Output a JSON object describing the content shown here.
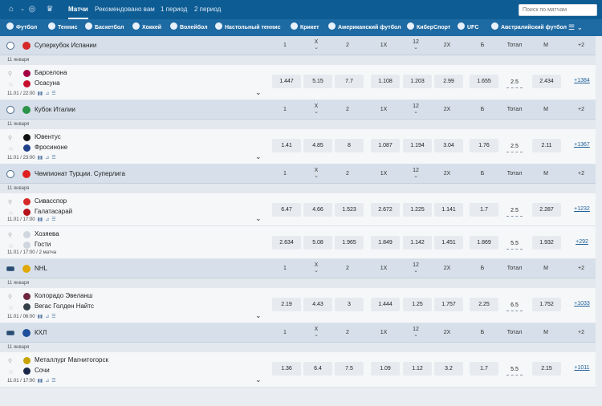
{
  "topbar": {
    "tabs": [
      {
        "label": "Матчи",
        "active": true
      },
      {
        "label": "Рекомендовано вам",
        "active": false
      },
      {
        "label": "1 период",
        "active": false
      },
      {
        "label": "2 период",
        "active": false
      }
    ],
    "search_placeholder": "Поиск по матчам"
  },
  "sports": [
    {
      "label": "Футбол",
      "icon": "football-icon"
    },
    {
      "label": "Теннис",
      "icon": "tennis-icon"
    },
    {
      "label": "Баскетбол",
      "icon": "basketball-icon"
    },
    {
      "label": "Хоккей",
      "icon": "hockey-icon"
    },
    {
      "label": "Волейбол",
      "icon": "volleyball-icon"
    },
    {
      "label": "Настольный теннис",
      "icon": "table-tennis-icon"
    },
    {
      "label": "Крикет",
      "icon": "cricket-icon"
    },
    {
      "label": "Американский футбол",
      "icon": "american-football-icon"
    },
    {
      "label": "КиберСпорт",
      "icon": "esports-icon"
    },
    {
      "label": "UFC",
      "icon": "ufc-icon"
    },
    {
      "label": "Австралийский футбол",
      "icon": "aussie-rules-icon"
    }
  ],
  "columns": [
    "1",
    "X",
    "2",
    "1X",
    "12",
    "2X",
    "Б",
    "Тотал",
    "М",
    "+2"
  ],
  "leagues": [
    {
      "name": "Суперкубок Испании",
      "sport": "football",
      "flag_color": "#d62828",
      "date": "11 января",
      "events": [
        {
          "team1": "Барселона",
          "team2": "Осасуна",
          "c1": "#a50044",
          "c2": "#c8102e",
          "time": "11.01 / 22:00",
          "extra": "",
          "odds": [
            "1.447",
            "5.15",
            "7.7",
            "1.108",
            "1.203",
            "2.99",
            "1.655"
          ],
          "total": "2.5",
          "under": "2.434",
          "more": "+1384"
        }
      ]
    },
    {
      "name": "Кубок Италии",
      "sport": "football",
      "flag_color": "#2b9348",
      "date": "11 января",
      "events": [
        {
          "team1": "Ювентус",
          "team2": "Фросиноне",
          "c1": "#111111",
          "c2": "#1e3f8a",
          "time": "11.01 / 23:00",
          "extra": "",
          "odds": [
            "1.41",
            "4.85",
            "8",
            "1.087",
            "1.194",
            "3.04",
            "1.76"
          ],
          "total": "2.5",
          "under": "2.11",
          "more": "+1367"
        }
      ]
    },
    {
      "name": "Чемпионат Турции. Суперлига",
      "sport": "football",
      "flag_color": "#e02020",
      "date": "11 января",
      "events": [
        {
          "team1": "Сивасспор",
          "team2": "Галатасарай",
          "c1": "#d62828",
          "c2": "#b5121b",
          "time": "11.01 / 17:00",
          "extra": "",
          "odds": [
            "6.47",
            "4.66",
            "1.523",
            "2.672",
            "1.225",
            "1.141",
            "1.7"
          ],
          "total": "2.5",
          "under": "2.287",
          "more": "+1232"
        },
        {
          "team1": "Хозяева",
          "team2": "Гости",
          "c1": "#cfd6de",
          "c2": "#cfd6de",
          "time": "11.01 / 17:00",
          "extra": "2 матча",
          "odds": [
            "2.634",
            "5.08",
            "1.965",
            "1.849",
            "1.142",
            "1.451",
            "1.869"
          ],
          "total": "5.5",
          "under": "1.932",
          "more": "+292"
        }
      ]
    },
    {
      "name": "NHL",
      "sport": "hockey",
      "flag_color": "#e0a800",
      "date": "11 января",
      "events": [
        {
          "team1": "Колорадо Эвеланш",
          "team2": "Вегас Голден Найтс",
          "c1": "#6f263d",
          "c2": "#333f48",
          "time": "11.01 / 06:00",
          "extra": "",
          "odds": [
            "2.19",
            "4.43",
            "3",
            "1.444",
            "1.25",
            "1.757",
            "2.25"
          ],
          "total": "6.5",
          "under": "1.752",
          "more": "+1033"
        }
      ]
    },
    {
      "name": "КХЛ",
      "sport": "hockey",
      "flag_color": "#1f4e9c",
      "date": "11 января",
      "events": [
        {
          "team1": "Металлург Магнитогорск",
          "team2": "Сочи",
          "c1": "#c8a200",
          "c2": "#1b2a4a",
          "time": "11.01 / 17:00",
          "extra": "",
          "odds": [
            "1.36",
            "6.4",
            "7.5",
            "1.09",
            "1.12",
            "3.2",
            "1.7"
          ],
          "total": "5.5",
          "under": "2.15",
          "more": "+1011"
        }
      ]
    }
  ]
}
